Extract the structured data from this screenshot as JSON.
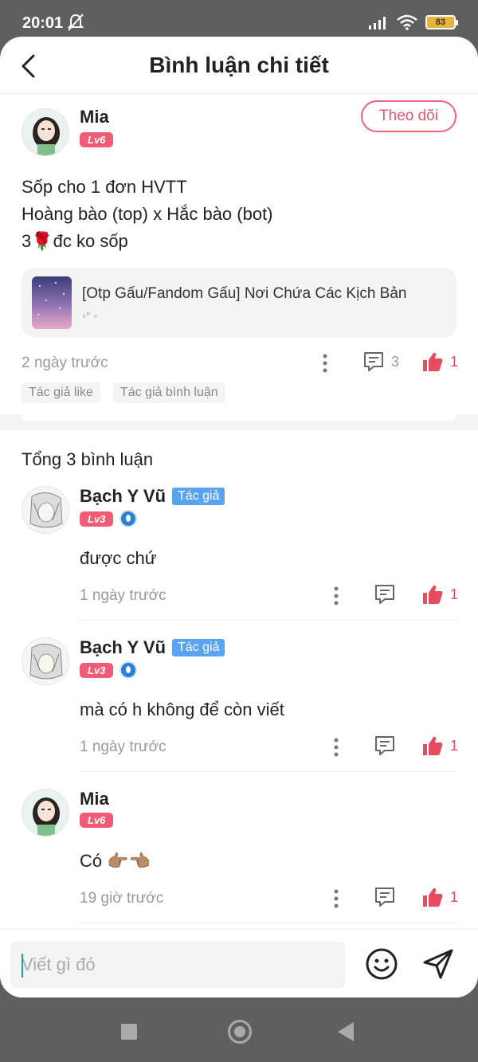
{
  "status_bar": {
    "time": "20:01",
    "battery": "83"
  },
  "header": {
    "title": "Bình luận chi tiết"
  },
  "post": {
    "author": {
      "name": "Mia",
      "level": "Lv6"
    },
    "follow_label": "Theo dõi",
    "lines": [
      "Sốp cho 1 đơn HVTT",
      "Hoàng bào (top) x Hắc bào (bot)",
      "3🌹đc ko sốp"
    ],
    "link_card": {
      "title": "[Otp Gấu/Fandom Gấu] Nơi Chứa Các Kịch Bản",
      "subtitle": "◦° ◦"
    },
    "time": "2 ngày trước",
    "comment_count": "3",
    "like_count": "1",
    "tags": [
      "Tác giả like",
      "Tác giả bình luận"
    ]
  },
  "comments_section": {
    "total_label": "Tổng 3 bình luận"
  },
  "comments": [
    {
      "name": "Bạch Y Vũ",
      "author_tag": "Tác giả",
      "level": "Lv3",
      "text": "được chứ",
      "time": "1 ngày trước",
      "likes": "1"
    },
    {
      "name": "Bạch Y Vũ",
      "author_tag": "Tác giả",
      "level": "Lv3",
      "text": "mà có h không để còn viết",
      "time": "1 ngày trước",
      "likes": "1"
    },
    {
      "name": "Mia",
      "author_tag": "",
      "level": "Lv6",
      "text": "Có 👉🏽👈🏽",
      "time": "19 giờ trước",
      "likes": "1"
    }
  ],
  "input": {
    "placeholder": "Viết gì đó"
  },
  "colors": {
    "accent": "#f0627b",
    "like": "#e84a5f",
    "author_tag": "#5aa3f0"
  }
}
